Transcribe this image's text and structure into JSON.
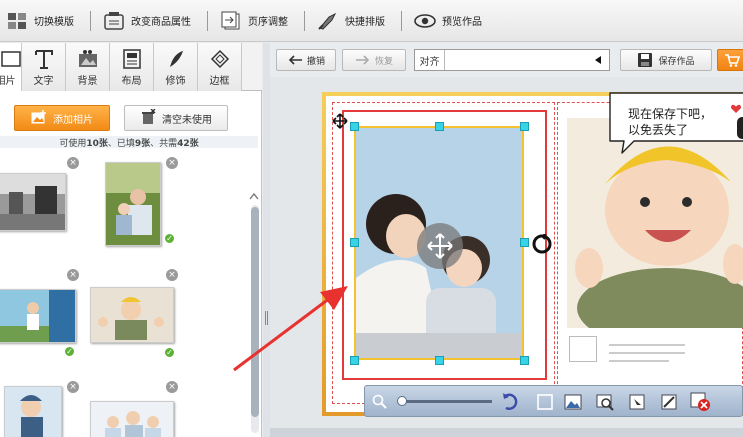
{
  "toolbar": {
    "items": [
      {
        "label": "切换模版",
        "icon": "template-grid-icon"
      },
      {
        "label": "改变商品属性",
        "icon": "product-attr-icon"
      },
      {
        "label": "页序调整",
        "icon": "page-order-icon"
      },
      {
        "label": "快捷排版",
        "icon": "quick-layout-icon"
      },
      {
        "label": "预览作品",
        "icon": "eye-icon"
      }
    ]
  },
  "categories": {
    "items": [
      {
        "label": "相片",
        "icon": "photo-icon"
      },
      {
        "label": "文字",
        "icon": "text-icon"
      },
      {
        "label": "背景",
        "icon": "background-icon"
      },
      {
        "label": "布局",
        "icon": "layout-icon"
      },
      {
        "label": "修饰",
        "icon": "decoration-icon"
      },
      {
        "label": "边框",
        "icon": "border-icon"
      }
    ]
  },
  "photo_panel": {
    "add_label": "添加相片",
    "clear_label": "清空未使用",
    "usage_prefix": "可使用",
    "usage_available": "10张",
    "usage_mid": "、已填",
    "usage_filled": "9张",
    "usage_mid2": "、共需",
    "usage_total": "42张"
  },
  "editor": {
    "undo_label": "撤销",
    "redo_label": "恢复",
    "align_label": "对齐",
    "save_label": "保存作品"
  },
  "bubble": {
    "line1": "现在保存下吧，",
    "line2": "以免丢失了"
  },
  "colors": {
    "accent_orange": "#f28a16",
    "selection_red": "#e23a3a",
    "frame_yellow": "#f2c230",
    "handle_cyan": "#38d3e6",
    "used_green": "#5db235"
  }
}
